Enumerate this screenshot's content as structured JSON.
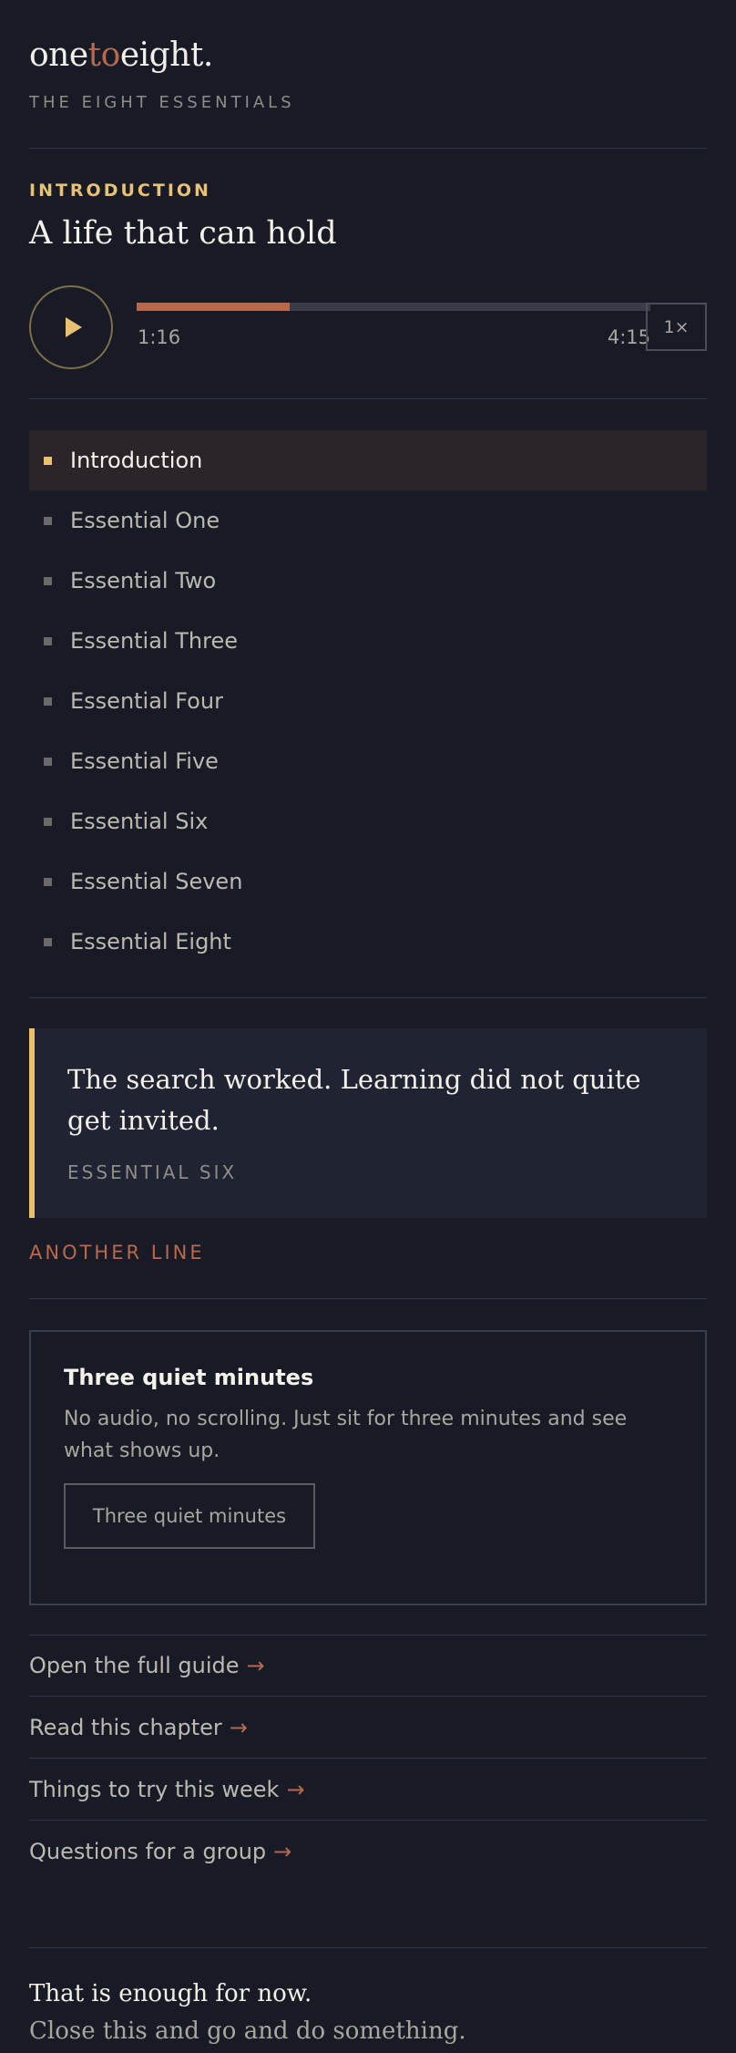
{
  "brand": {
    "part1": "one",
    "part2": "to",
    "part3": "eight."
  },
  "tagline": "THE EIGHT ESSENTIALS",
  "player": {
    "section": "INTRODUCTION",
    "title": "A life that can hold",
    "current_time": "1:16",
    "total_time": "4:15",
    "progress": 0.298,
    "speed": "1×"
  },
  "chapters": [
    {
      "label": "Introduction",
      "active": true
    },
    {
      "label": "Essential One",
      "active": false
    },
    {
      "label": "Essential Two",
      "active": false
    },
    {
      "label": "Essential Three",
      "active": false
    },
    {
      "label": "Essential Four",
      "active": false
    },
    {
      "label": "Essential Five",
      "active": false
    },
    {
      "label": "Essential Six",
      "active": false
    },
    {
      "label": "Essential Seven",
      "active": false
    },
    {
      "label": "Essential Eight",
      "active": false
    }
  ],
  "quote": {
    "text": "The search worked. Learning did not quite get invited.",
    "source": "ESSENTIAL SIX",
    "another_line": "ANOTHER LINE"
  },
  "card": {
    "title": "Three quiet minutes",
    "body": "No audio, no scrolling. Just sit for three minutes and see what shows up.",
    "button": "Three quiet minutes"
  },
  "links": [
    {
      "label": "Open the full guide",
      "arrow": "→"
    },
    {
      "label": "Read this chapter",
      "arrow": "→"
    },
    {
      "label": "Things to try this week",
      "arrow": "→"
    },
    {
      "label": "Questions for a group",
      "arrow": "→"
    }
  ],
  "footer": {
    "line1": "That is enough for now.",
    "line2": "Close this and go and do something."
  },
  "colors": {
    "background": "#181b25",
    "gold_accent": "#e8c173",
    "rust_accent": "#b8694c"
  }
}
